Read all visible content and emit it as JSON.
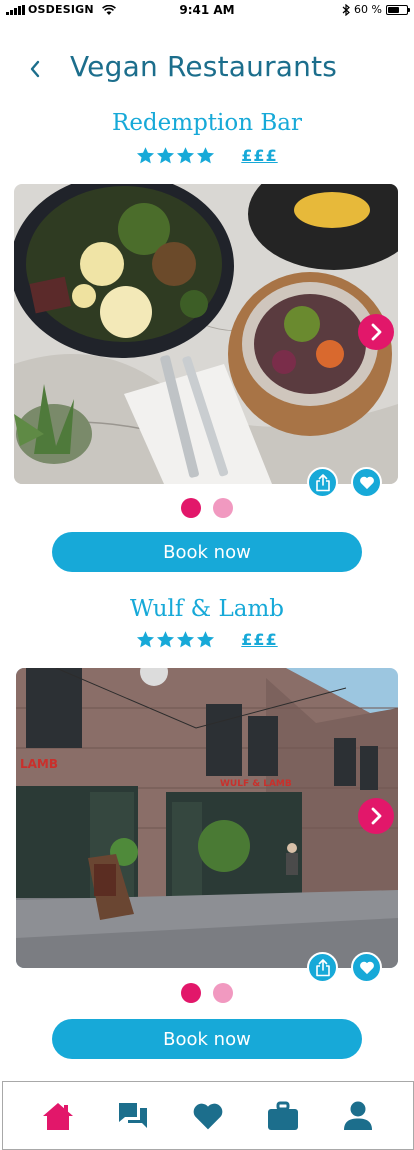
{
  "status_bar": {
    "carrier": "OSDESIGN",
    "time": "9:41 AM",
    "battery": "60 %",
    "battery_level": 0.6
  },
  "header": {
    "title": "Vegan Restaurants",
    "back_icon": "chevron-left-icon"
  },
  "restaurants": [
    {
      "name": "Redemption Bar",
      "rating": 4,
      "price": "£££",
      "photo": "food-bowls-photo",
      "active_slide": 1,
      "slides": 2,
      "book_label": "Book now"
    },
    {
      "name": "Wulf & Lamb",
      "rating": 4,
      "price": "£££",
      "photo": "restaurant-exterior-photo",
      "storefront_sign": "WULF & LAMB",
      "side_sign": "LAMB",
      "active_slide": 1,
      "slides": 2,
      "book_label": "Book now"
    }
  ],
  "tab_bar": {
    "items": [
      {
        "name": "home",
        "icon": "home-icon",
        "active": true
      },
      {
        "name": "messages",
        "icon": "chat-icon",
        "active": false
      },
      {
        "name": "favourites",
        "icon": "heart-icon",
        "active": false
      },
      {
        "name": "bookings",
        "icon": "briefcase-icon",
        "active": false
      },
      {
        "name": "profile",
        "icon": "person-icon",
        "active": false
      }
    ]
  },
  "colors": {
    "primary_blue": "#17a9d8",
    "title_teal": "#1c6e8c",
    "accent_pink": "#e2176a",
    "inactive_pink": "#f199c0"
  }
}
